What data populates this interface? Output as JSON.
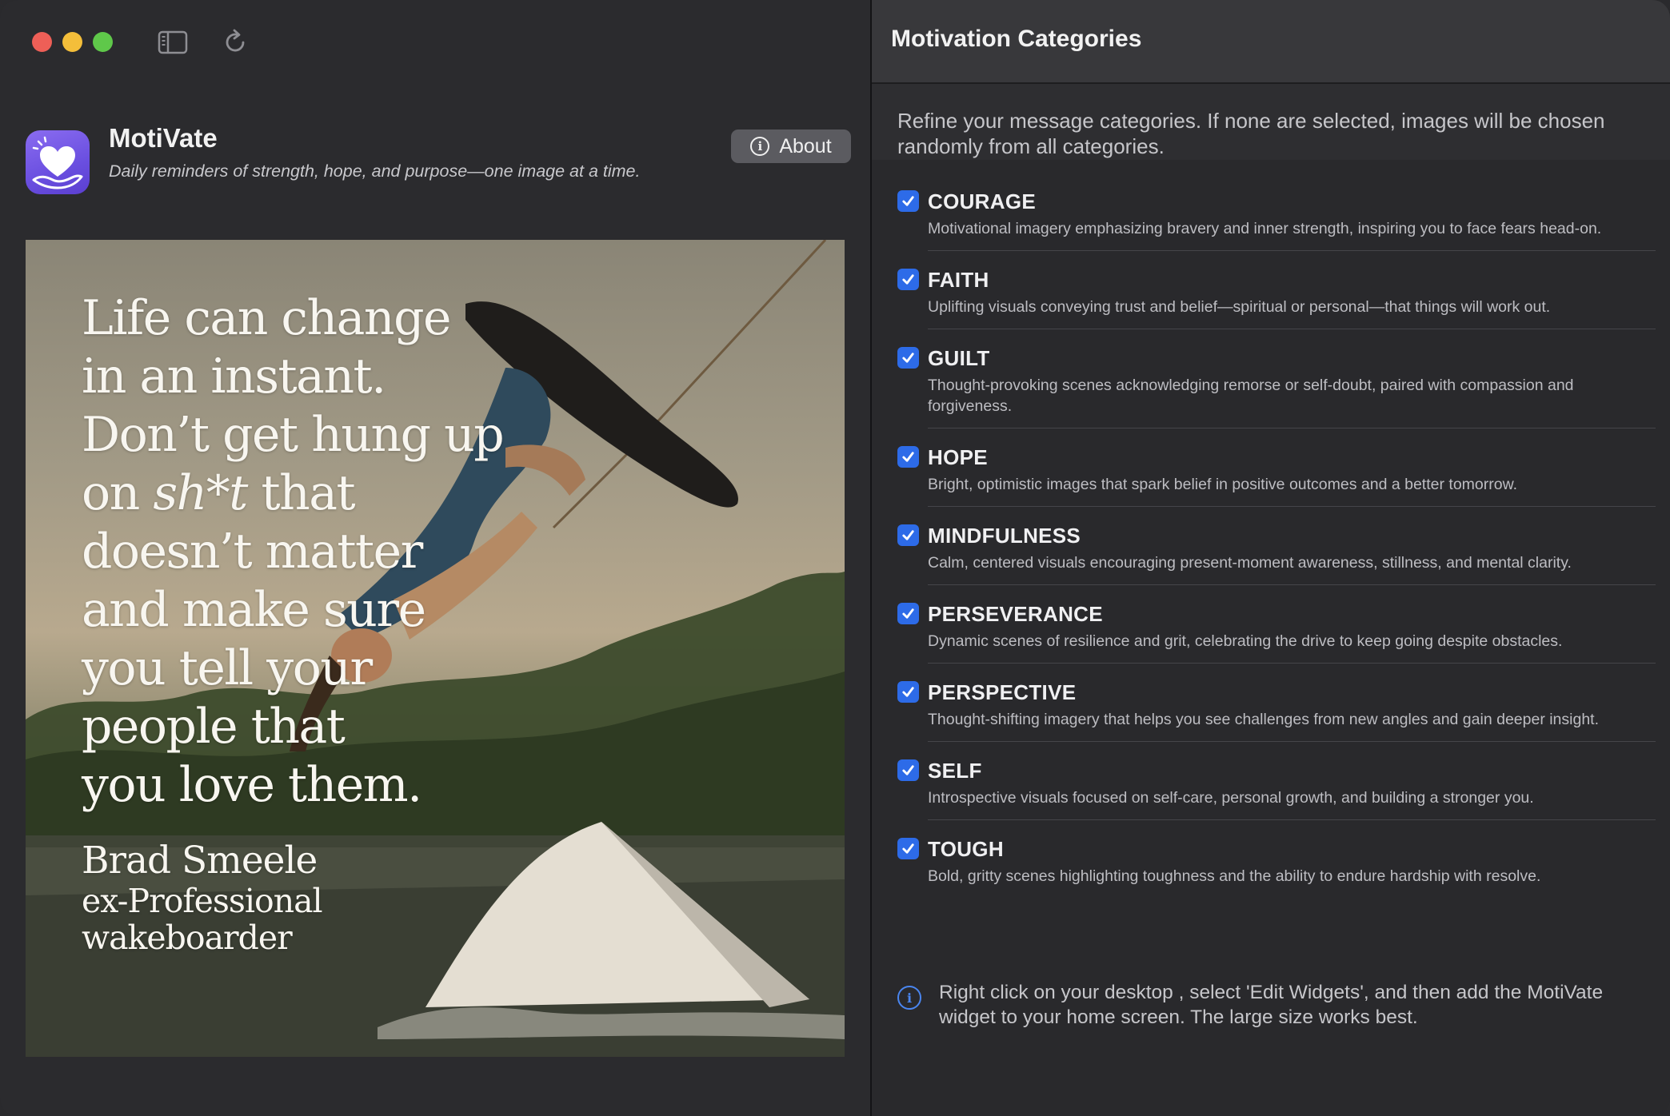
{
  "window": {
    "controls": [
      "close",
      "minimize",
      "zoom"
    ],
    "toolbar_icons": [
      "sidebar-toggle-icon",
      "reload-icon"
    ]
  },
  "app": {
    "name": "MotiVate",
    "tagline": "Daily reminders of strength, hope, and purpose—one image at a time.",
    "about_label": "About",
    "icon": "heart-hand-icon"
  },
  "image": {
    "quote_lines": [
      "Life can change",
      "in an instant.",
      "Don’t get hung up",
      "on ",
      "sh*t",
      " that",
      "doesn’t matter",
      "and make sure",
      "you tell your",
      "people that",
      "you love them."
    ],
    "author_name": "Brad Smeele",
    "author_role_1": "ex-Professional",
    "author_role_2": "wakeboarder"
  },
  "panel": {
    "title": "Motivation Categories",
    "intro": "Refine your message categories. If none are selected, images will be chosen randomly from all categories.",
    "categories": [
      {
        "name": "COURAGE",
        "checked": true,
        "description": "Motivational imagery emphasizing bravery and inner strength, inspiring you to face fears head-on."
      },
      {
        "name": "FAITH",
        "checked": true,
        "description": "Uplifting visuals conveying trust and belief—spiritual or personal—that things will work out."
      },
      {
        "name": "GUILT",
        "checked": true,
        "description": "Thought-provoking scenes acknowledging remorse or self-doubt, paired with compassion and forgiveness."
      },
      {
        "name": "HOPE",
        "checked": true,
        "description": "Bright, optimistic images that spark belief in positive outcomes and a better tomorrow."
      },
      {
        "name": "MINDFULNESS",
        "checked": true,
        "description": "Calm, centered visuals encouraging present-moment awareness, stillness, and mental clarity."
      },
      {
        "name": "PERSEVERANCE",
        "checked": true,
        "description": "Dynamic scenes of resilience and grit, celebrating the drive to keep going despite obstacles."
      },
      {
        "name": "PERSPECTIVE",
        "checked": true,
        "description": "Thought-shifting imagery that helps you see challenges from new angles and gain deeper insight."
      },
      {
        "name": "SELF",
        "checked": true,
        "description": "Introspective visuals focused on self-care, personal growth, and building a stronger you."
      },
      {
        "name": "TOUGH",
        "checked": true,
        "description": "Bold, gritty scenes highlighting toughness and the ability to endure hardship with resolve."
      }
    ],
    "hint": "Right click on your desktop , select 'Edit Widgets', and then add the MotiVate widget to your home screen. The large size works best."
  },
  "colors": {
    "accent": "#2d6be8",
    "info": "#4a86f0"
  }
}
